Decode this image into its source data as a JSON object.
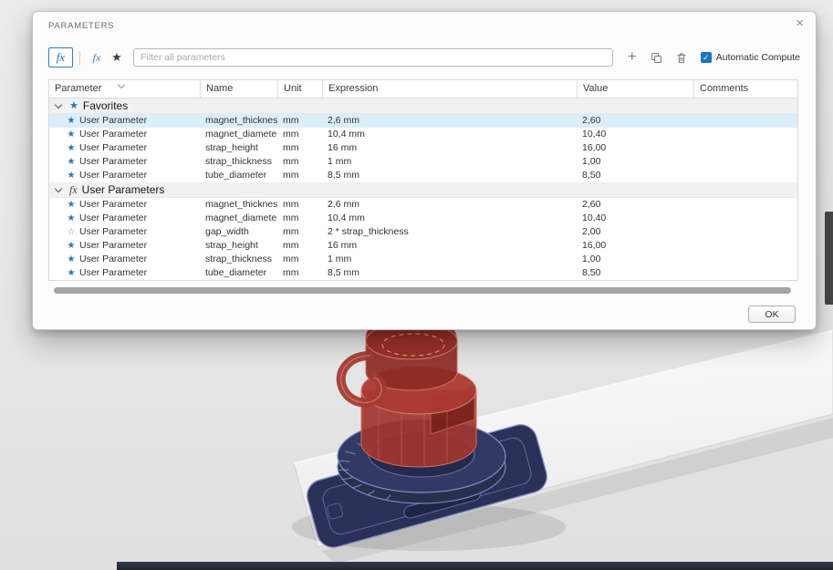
{
  "icons": {
    "close": "×",
    "fx": "fx",
    "star_filled": "★",
    "star_outline": "☆",
    "plus": "+",
    "check": "✓"
  },
  "colors": {
    "accent_blue": "#1b75c0",
    "selected_row": "#dceefa",
    "group_row": "#f1f1f1",
    "model_red": "#a23530",
    "model_navy": "#2a3158"
  },
  "dialog": {
    "title": "PARAMETERS",
    "toolbar": {
      "filter_placeholder": "Filter all parameters",
      "auto_compute_label": "Automatic Compute",
      "auto_compute_checked": true
    },
    "table": {
      "columns": [
        "Parameter",
        "Name",
        "Unit",
        "Expression",
        "Value",
        "Comments"
      ],
      "groups": [
        {
          "label": "Favorites",
          "icon": "star",
          "rows": [
            {
              "parameter": "User Parameter",
              "favorite": true,
              "name": "magnet_thickness",
              "unit": "mm",
              "expression": "2,6 mm",
              "value": "2,60",
              "comments": "",
              "selected": true
            },
            {
              "parameter": "User Parameter",
              "favorite": true,
              "name": "magnet_diameter",
              "unit": "mm",
              "expression": "10,4 mm",
              "value": "10,40",
              "comments": ""
            },
            {
              "parameter": "User Parameter",
              "favorite": true,
              "name": "strap_height",
              "unit": "mm",
              "expression": "16 mm",
              "value": "16,00",
              "comments": ""
            },
            {
              "parameter": "User Parameter",
              "favorite": true,
              "name": "strap_thickness",
              "unit": "mm",
              "expression": "1 mm",
              "value": "1,00",
              "comments": ""
            },
            {
              "parameter": "User Parameter",
              "favorite": true,
              "name": "tube_diameter",
              "unit": "mm",
              "expression": "8,5 mm",
              "value": "8,50",
              "comments": ""
            }
          ]
        },
        {
          "label": "User Parameters",
          "icon": "fx",
          "rows": [
            {
              "parameter": "User Parameter",
              "favorite": true,
              "name": "magnet_thickness",
              "unit": "mm",
              "expression": "2,6 mm",
              "value": "2,60",
              "comments": ""
            },
            {
              "parameter": "User Parameter",
              "favorite": true,
              "name": "magnet_diameter",
              "unit": "mm",
              "expression": "10,4 mm",
              "value": "10,40",
              "comments": ""
            },
            {
              "parameter": "User Parameter",
              "favorite": false,
              "name": "gap_width",
              "unit": "mm",
              "expression": "2 * strap_thickness",
              "value": "2,00",
              "comments": ""
            },
            {
              "parameter": "User Parameter",
              "favorite": true,
              "name": "strap_height",
              "unit": "mm",
              "expression": "16 mm",
              "value": "16,00",
              "comments": ""
            },
            {
              "parameter": "User Parameter",
              "favorite": true,
              "name": "strap_thickness",
              "unit": "mm",
              "expression": "1 mm",
              "value": "1,00",
              "comments": ""
            },
            {
              "parameter": "User Parameter",
              "favorite": true,
              "name": "tube_diameter",
              "unit": "mm",
              "expression": "8,5 mm",
              "value": "8,50",
              "comments": ""
            }
          ]
        }
      ]
    },
    "ok_label": "OK"
  }
}
